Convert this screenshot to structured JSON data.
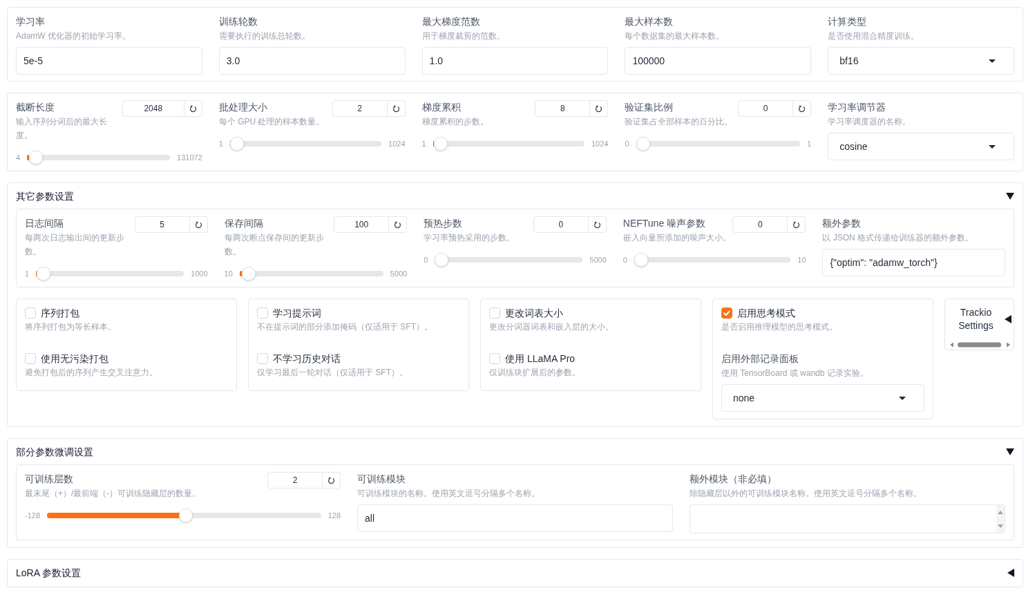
{
  "main_settings": {
    "fields": [
      {
        "kind": "text",
        "label": "学习率",
        "info": "AdamW 优化器的初始学习率。",
        "value": "5e-5"
      },
      {
        "kind": "text",
        "label": "训练轮数",
        "info": "需要执行的训练总轮数。",
        "value": "3.0"
      },
      {
        "kind": "text",
        "label": "最大梯度范数",
        "info": "用于梯度裁剪的范数。",
        "value": "1.0"
      },
      {
        "kind": "text",
        "label": "最大样本数",
        "info": "每个数据集的最大样本数。",
        "value": "100000"
      },
      {
        "kind": "dropdown",
        "label": "计算类型",
        "info": "是否使用混合精度训练。",
        "value": "bf16"
      }
    ]
  },
  "slider_settings": {
    "fields": [
      {
        "kind": "slider",
        "label": "截断长度",
        "info": "输入序列分词后的最大长度。",
        "value": "2048",
        "min": "4",
        "max": "131072",
        "level": 0.016
      },
      {
        "kind": "slider",
        "label": "批处理大小",
        "info": "每个 GPU 处理的样本数量。",
        "value": "2",
        "min": "1",
        "max": "1024",
        "level": 0.001
      },
      {
        "kind": "slider",
        "label": "梯度累积",
        "info": "梯度累积的步数。",
        "value": "8",
        "min": "1",
        "max": "1024",
        "level": 0.007
      },
      {
        "kind": "slider",
        "label": "验证集比例",
        "info": "验证集占全部样本的百分比。",
        "value": "0",
        "min": "0",
        "max": "1",
        "level": 0
      },
      {
        "kind": "dropdown",
        "label": "学习率调节器",
        "info": "学习率调度器的名称。",
        "value": "cosine"
      }
    ]
  },
  "other_settings": {
    "title": "其它参数设置",
    "expanded": true,
    "fields": [
      {
        "kind": "slider",
        "label": "日志间隔",
        "info": "每两次日志输出间的更新步数。",
        "value": "5",
        "min": "1",
        "max": "1000",
        "level": 0.004
      },
      {
        "kind": "slider",
        "label": "保存间隔",
        "info": "每两次断点保存间的更新步数。",
        "value": "100",
        "min": "10",
        "max": "5000",
        "level": 0.018
      },
      {
        "kind": "slider",
        "label": "预热步数",
        "info": "学习率预热采用的步数。",
        "value": "0",
        "min": "0",
        "max": "5000",
        "level": 0
      },
      {
        "kind": "slider",
        "label": "NEFTune 噪声参数",
        "info": "嵌入向量所添加的噪声大小。",
        "value": "0",
        "min": "0",
        "max": "10",
        "level": 0
      },
      {
        "kind": "text",
        "label": "额外参数",
        "info": "以 JSON 格式传递给训练器的额外参数。",
        "value": "{\"optim\": \"adamw_torch\"}"
      }
    ],
    "groups": [
      {
        "items": [
          {
            "kind": "checkbox",
            "label": "序列打包",
            "info": "将序列打包为等长样本。",
            "checked": false
          },
          {
            "kind": "checkbox",
            "label": "使用无污染打包",
            "info": "避免打包后的序列产生交叉注意力。",
            "checked": false
          }
        ]
      },
      {
        "items": [
          {
            "kind": "checkbox",
            "label": "学习提示词",
            "info": "不在提示词的部分添加掩码（仅适用于 SFT）。",
            "checked": false
          },
          {
            "kind": "checkbox",
            "label": "不学习历史对话",
            "info": "仅学习最后一轮对话（仅适用于 SFT）。",
            "checked": false
          }
        ]
      },
      {
        "items": [
          {
            "kind": "checkbox",
            "label": "更改词表大小",
            "info": "更改分词器词表和嵌入层的大小。",
            "checked": false
          },
          {
            "kind": "checkbox",
            "label": "使用 LLaMA Pro",
            "info": "仅训练块扩展后的参数。",
            "checked": false
          }
        ]
      },
      {
        "items": [
          {
            "kind": "checkbox",
            "label": "启用思考模式",
            "info": "是否启用推理模型的思考模式。",
            "checked": true
          },
          {
            "kind": "dropdown",
            "label": "启用外部记录面板",
            "info": "使用 TensorBoard 或 wandb 记录实验。",
            "value": "none"
          }
        ]
      }
    ],
    "side_accordion": {
      "title": "Trackio Settings",
      "expanded": false
    }
  },
  "freeze_settings": {
    "title": "部分参数微调设置",
    "expanded": true,
    "fields": [
      {
        "kind": "slider",
        "label": "可训练层数",
        "info": "最末尾（+）/最前端（-）可训练隐藏层的数量。",
        "value": "2",
        "min": "-128",
        "max": "128",
        "level": 0.508
      },
      {
        "kind": "text",
        "label": "可训练模块",
        "info": "可训练模块的名称。使用英文逗号分隔多个名称。",
        "value": "all"
      },
      {
        "kind": "textarea",
        "label": "额外模块（非必填）",
        "info": "除隐藏层以外的可训练模块名称。使用英文逗号分隔多个名称。"
      }
    ]
  },
  "lora_settings": {
    "title": "LoRA 参数设置",
    "expanded": false
  }
}
